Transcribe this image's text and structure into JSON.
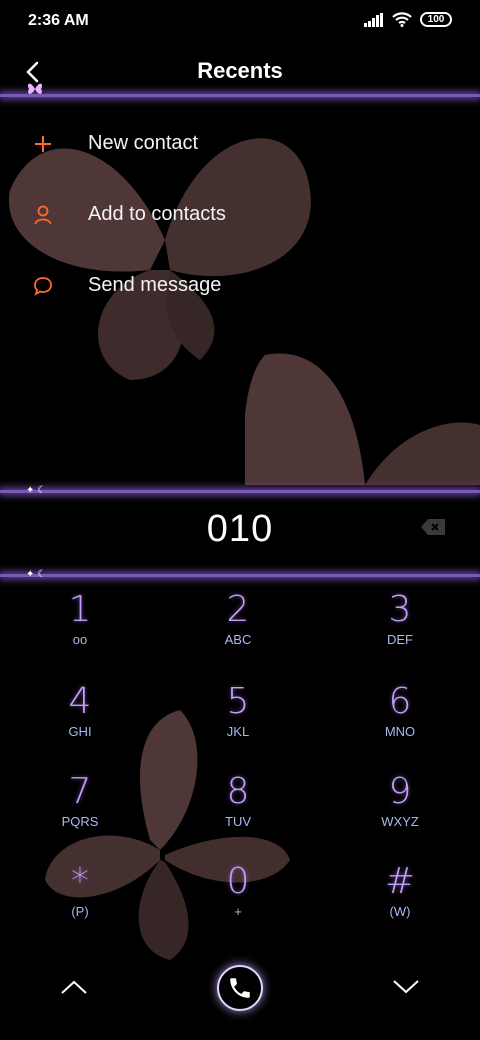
{
  "status": {
    "time": "2:36 AM",
    "battery": "100"
  },
  "header": {
    "title": "Recents"
  },
  "actions": [
    {
      "label": "New contact",
      "icon": "plus-icon"
    },
    {
      "label": "Add to contacts",
      "icon": "person-icon"
    },
    {
      "label": "Send message",
      "icon": "message-icon"
    }
  ],
  "dialer": {
    "number": "010"
  },
  "keypad": [
    {
      "digit": "1",
      "letters": "oo"
    },
    {
      "digit": "2",
      "letters": "ABC"
    },
    {
      "digit": "3",
      "letters": "DEF"
    },
    {
      "digit": "4",
      "letters": "GHI"
    },
    {
      "digit": "5",
      "letters": "JKL"
    },
    {
      "digit": "6",
      "letters": "MNO"
    },
    {
      "digit": "7",
      "letters": "PQRS"
    },
    {
      "digit": "8",
      "letters": "TUV"
    },
    {
      "digit": "9",
      "letters": "WXYZ"
    },
    {
      "digit": "*",
      "letters": "(P)"
    },
    {
      "digit": "0",
      "letters": "+"
    },
    {
      "digit": "#",
      "letters": "(W)"
    }
  ],
  "colors": {
    "accent": "#ff6a2a",
    "keypad": "#c39cf5",
    "glow": "#7a5ab8"
  }
}
